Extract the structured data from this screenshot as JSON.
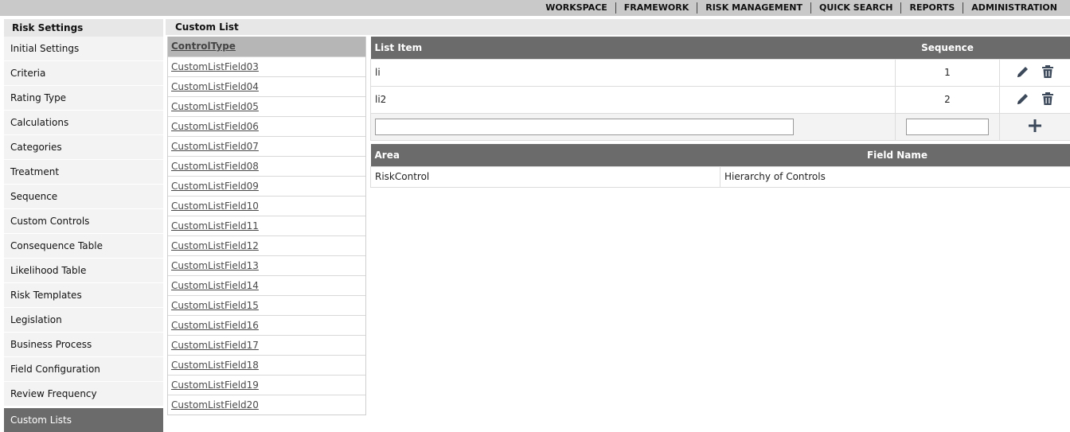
{
  "topnav": {
    "items": [
      "WORKSPACE",
      "FRAMEWORK",
      "RISK MANAGEMENT",
      "QUICK SEARCH",
      "REPORTS",
      "ADMINISTRATION"
    ]
  },
  "sidebar": {
    "title": "Risk Settings",
    "items": [
      "Initial Settings",
      "Criteria",
      "Rating Type",
      "Calculations",
      "Categories",
      "Treatment",
      "Sequence",
      "Custom Controls",
      "Consequence Table",
      "Likelihood Table",
      "Risk Templates",
      "Legislation",
      "Business Process",
      "Field Configuration",
      "Review Frequency",
      "Custom Lists"
    ],
    "active": "Custom Lists"
  },
  "main": {
    "title": "Custom List"
  },
  "control_list": {
    "header": "ControlType",
    "items": [
      "CustomListField03",
      "CustomListField04",
      "CustomListField05",
      "CustomListField06",
      "CustomListField07",
      "CustomListField08",
      "CustomListField09",
      "CustomListField10",
      "CustomListField11",
      "CustomListField12",
      "CustomListField13",
      "CustomListField14",
      "CustomListField15",
      "CustomListField16",
      "CustomListField17",
      "CustomListField18",
      "CustomListField19",
      "CustomListField20"
    ]
  },
  "list_table": {
    "headers": {
      "item": "List Item",
      "sequence": "Sequence"
    },
    "rows": [
      {
        "item": "li",
        "sequence": "1"
      },
      {
        "item": "li2",
        "sequence": "2"
      }
    ],
    "new_item": {
      "value": "",
      "placeholder": ""
    },
    "new_sequence": {
      "value": "",
      "placeholder": ""
    }
  },
  "area_table": {
    "headers": {
      "area": "Area",
      "field_name": "Field Name"
    },
    "rows": [
      {
        "area": "RiskControl",
        "field_name": "Hierarchy of Controls"
      }
    ]
  },
  "icons": {
    "edit": "pencil-icon",
    "delete": "trash-icon",
    "add": "plus-icon"
  },
  "colors": {
    "header_dark": "#6b6b6b",
    "icon": "#3d4a5c",
    "active_sidebar": "#6b6b6b"
  }
}
